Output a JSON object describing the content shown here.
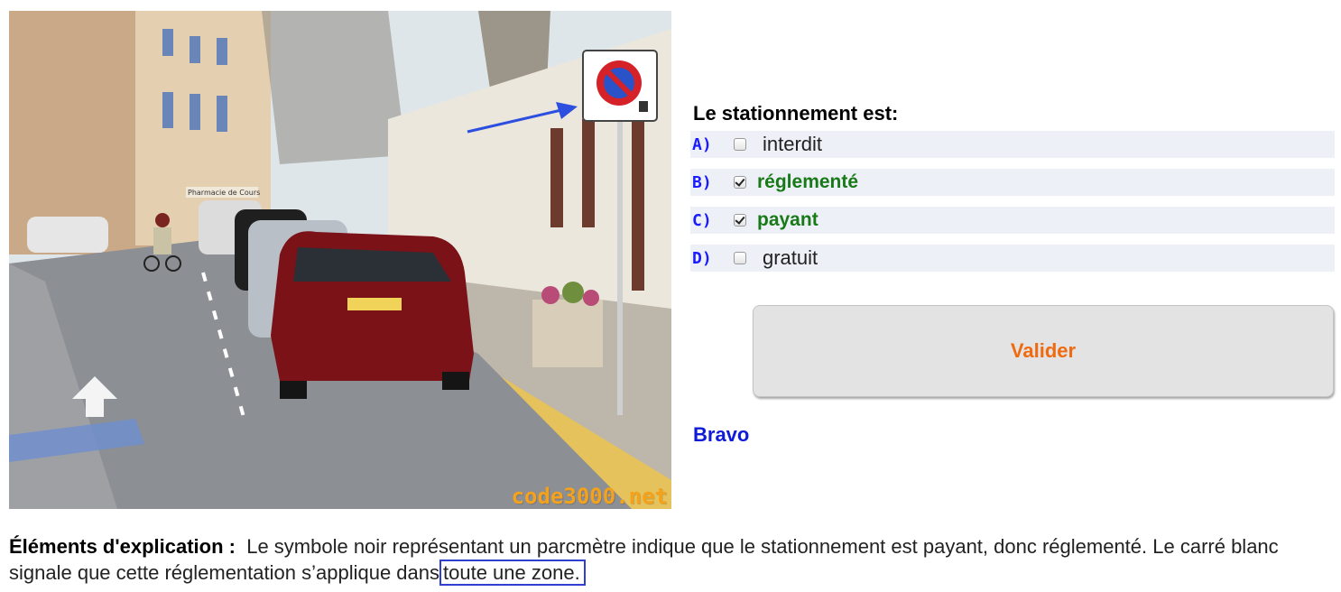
{
  "photo": {
    "watermark": "code3000.net",
    "shop_sign": "Pharmacie de Cours"
  },
  "question": {
    "title": "Le stationnement est:",
    "answers": [
      {
        "letter": "A)",
        "label": "interdit",
        "checked": false,
        "correct": false
      },
      {
        "letter": "B)",
        "label": "réglementé",
        "checked": true,
        "correct": true
      },
      {
        "letter": "C)",
        "label": "payant",
        "checked": true,
        "correct": true
      },
      {
        "letter": "D)",
        "label": "gratuit",
        "checked": false,
        "correct": false
      }
    ]
  },
  "actions": {
    "validate_label": "Valider"
  },
  "feedback": {
    "result": "Bravo"
  },
  "explanation": {
    "label": "Éléments d'explication :",
    "text": "Le symbole noir représentant un parcmètre indique que le stationnement est payant, donc réglementé. Le carré blanc signale que cette réglementation s’applique dans",
    "highlight": "toute une zone."
  },
  "colors": {
    "letter": "#1a1aff",
    "correct_answer": "#177a17",
    "button_text": "#ef6a10",
    "bravo": "#0f1bd6",
    "highlight_border": "#2f3fd0",
    "watermark": "#f4a21c"
  }
}
